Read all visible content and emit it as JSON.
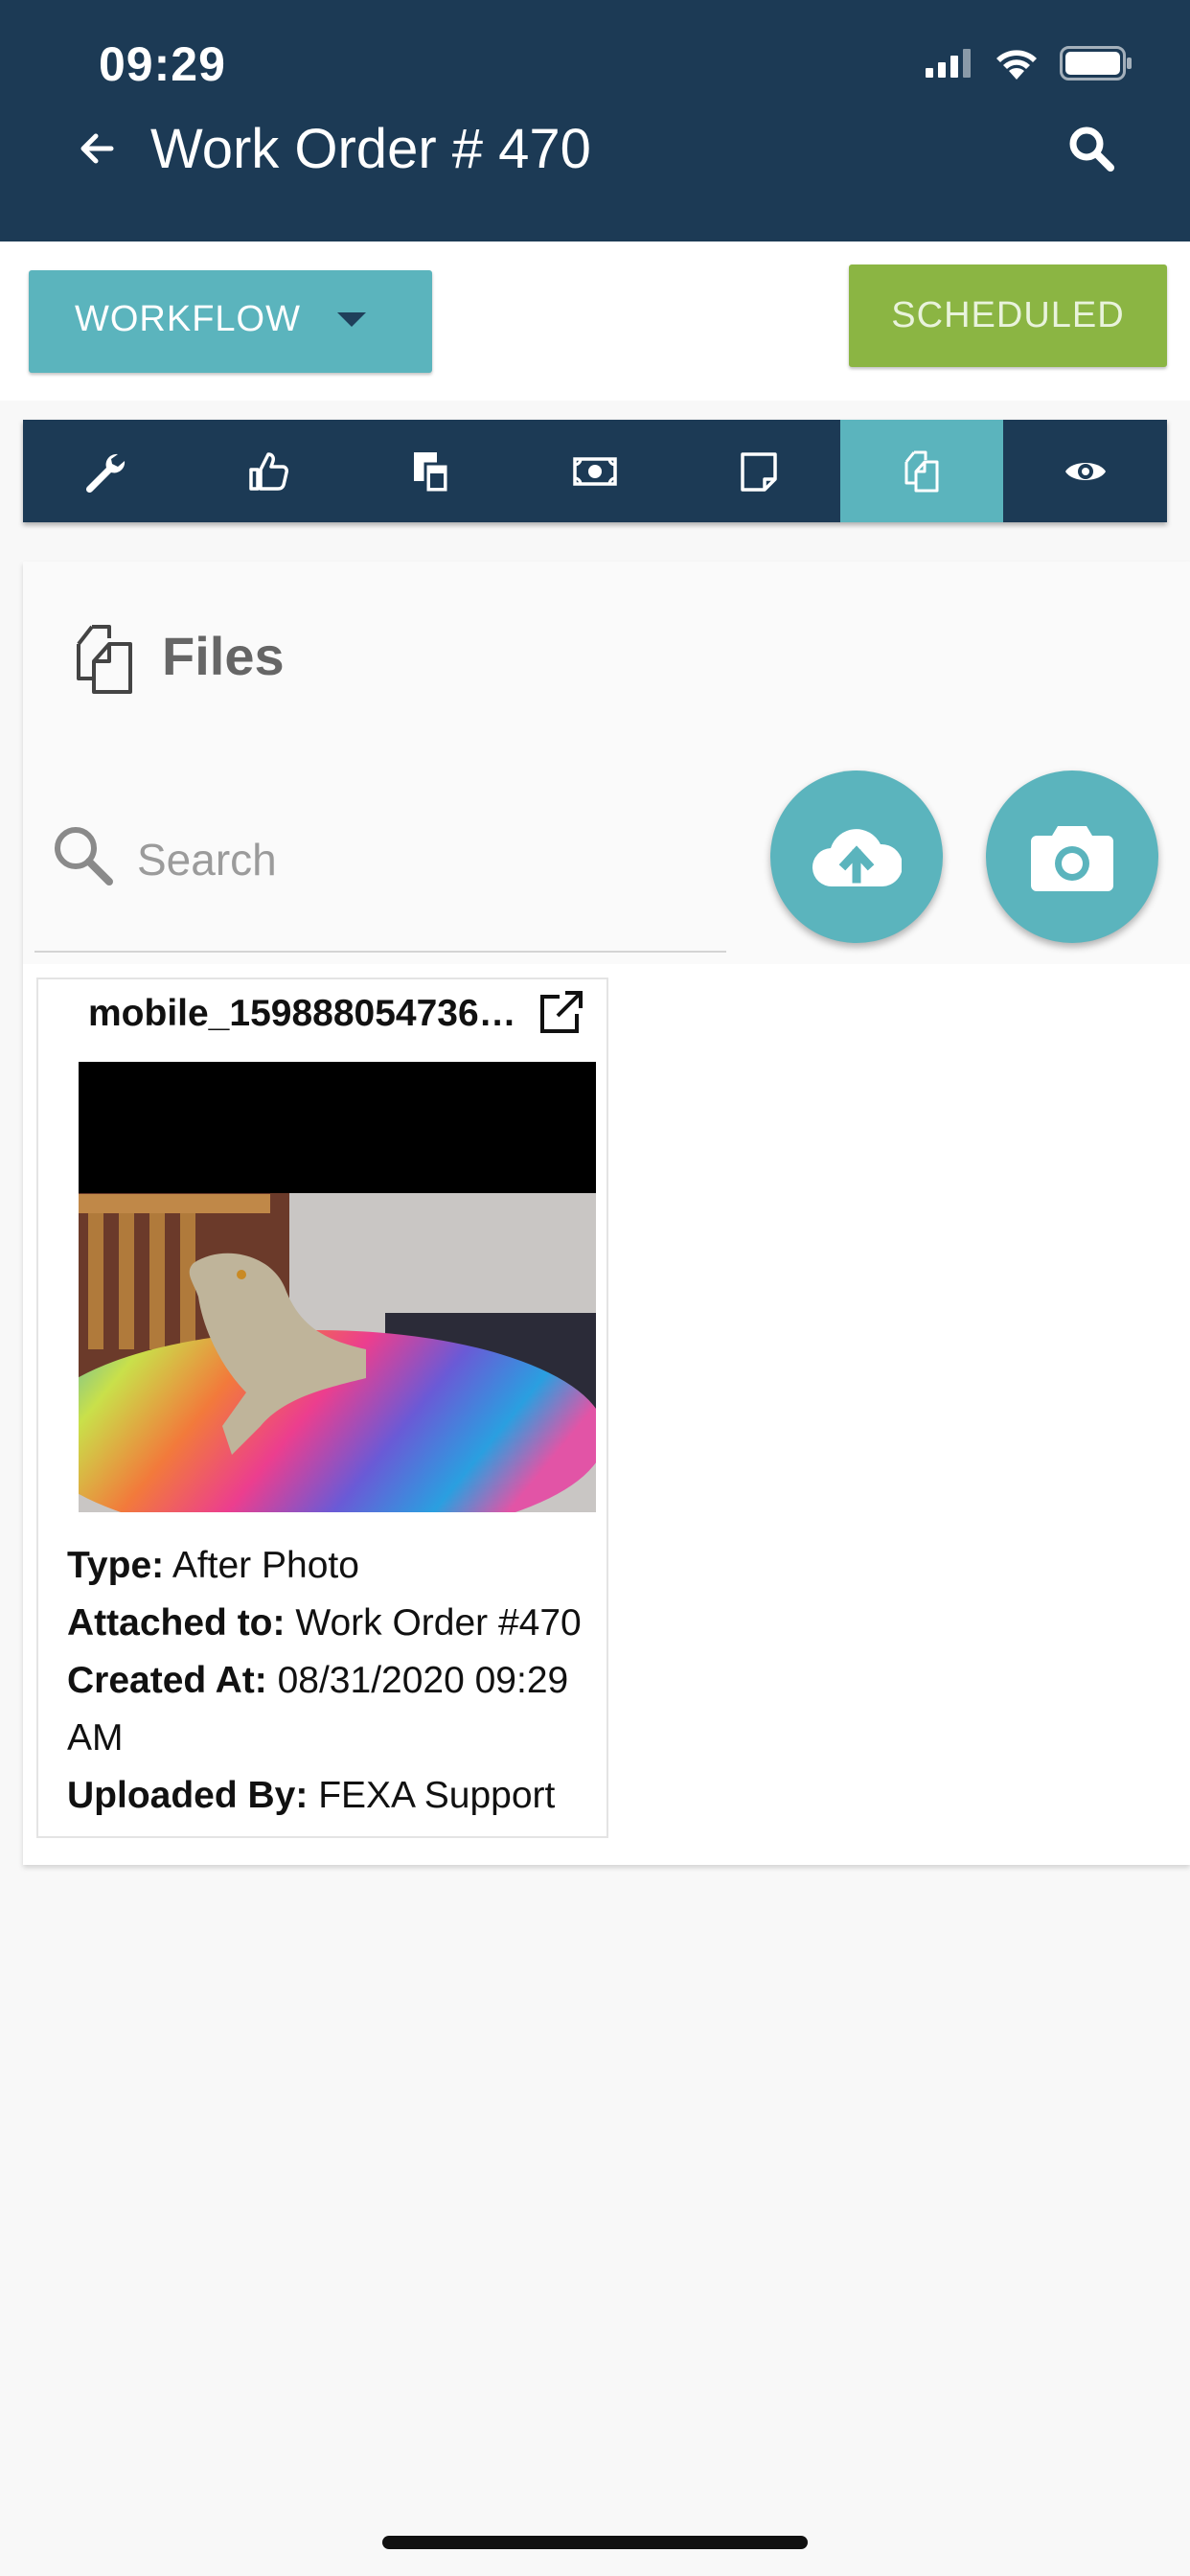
{
  "status_bar": {
    "time": "09:29"
  },
  "header": {
    "title": "Work Order # 470"
  },
  "actions": {
    "workflow_label": "WORKFLOW",
    "status_label": "SCHEDULED"
  },
  "tabs": [
    {
      "icon": "wrench-icon",
      "active": false
    },
    {
      "icon": "thumbs-up-icon",
      "active": false
    },
    {
      "icon": "copy-documents-icon",
      "active": false
    },
    {
      "icon": "money-icon",
      "active": false
    },
    {
      "icon": "note-icon",
      "active": false
    },
    {
      "icon": "files-icon",
      "active": true
    },
    {
      "icon": "eye-icon",
      "active": false
    }
  ],
  "files": {
    "title": "Files",
    "search_placeholder": "Search",
    "items": [
      {
        "name": "mobile_159888054736…",
        "type_label": "Type:",
        "type_value": "After Photo",
        "attached_label": "Attached to:",
        "attached_value": "Work Order #470",
        "created_label": "Created At:",
        "created_value": "08/31/2020 09:29 AM",
        "uploaded_label": "Uploaded By:",
        "uploaded_value": "FEXA Support"
      }
    ]
  },
  "colors": {
    "header_bg": "#1c3a55",
    "accent_teal": "#5bb4bd",
    "scheduled_green": "#8bb543"
  }
}
